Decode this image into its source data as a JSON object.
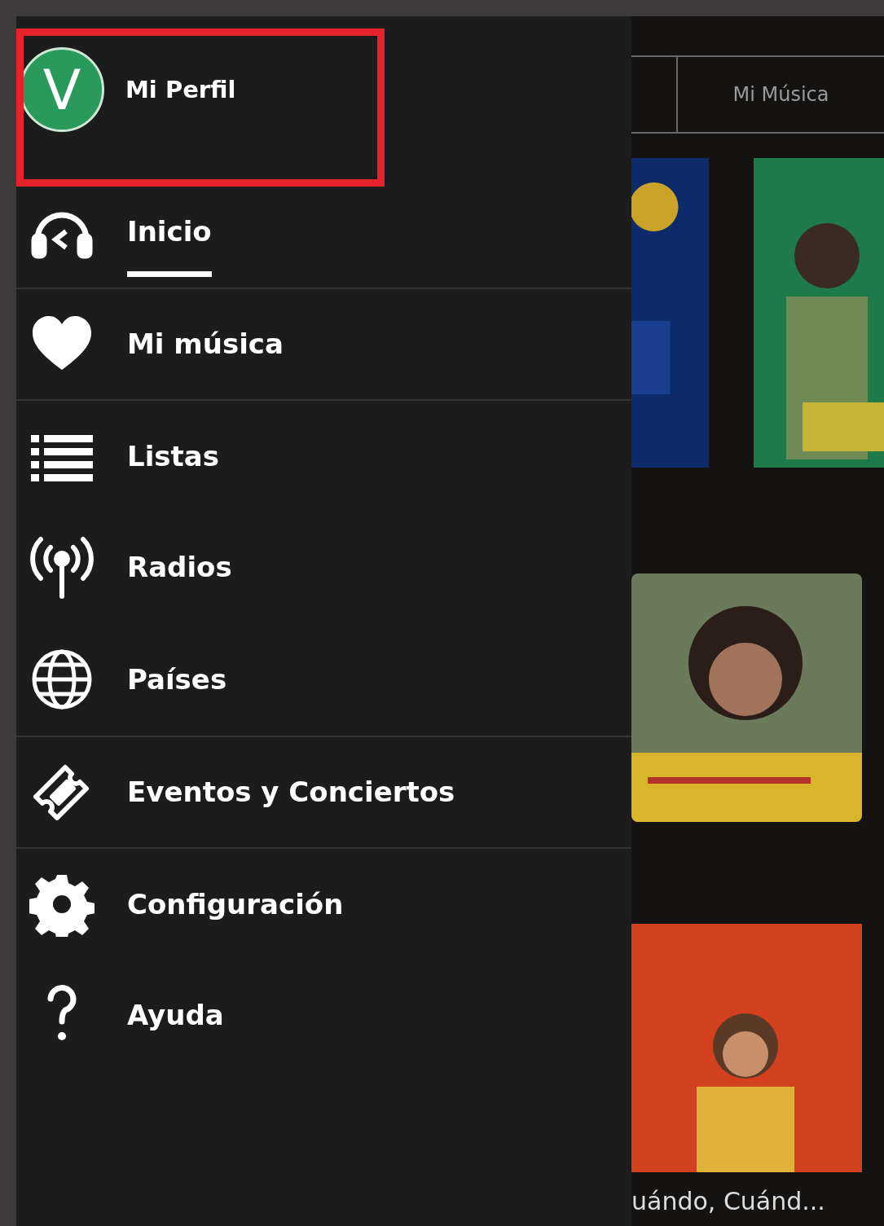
{
  "profile": {
    "initial": "V",
    "name": "Mi Perfil",
    "highlighted": true
  },
  "menu": [
    {
      "label": "Inicio",
      "selected": true
    },
    {
      "label": "Mi música",
      "selected": false
    },
    {
      "label": "Listas",
      "selected": false
    },
    {
      "label": "Radios",
      "selected": false
    },
    {
      "label": "Países",
      "selected": false
    },
    {
      "label": "Eventos y Conciertos",
      "selected": false
    },
    {
      "label": "Configuración",
      "selected": false
    },
    {
      "label": "Ayuda",
      "selected": false
    }
  ],
  "tabs": [
    {
      "label": "Mi Música",
      "selected": false
    }
  ],
  "captions": [
    "uándo, Cuánd..."
  ]
}
